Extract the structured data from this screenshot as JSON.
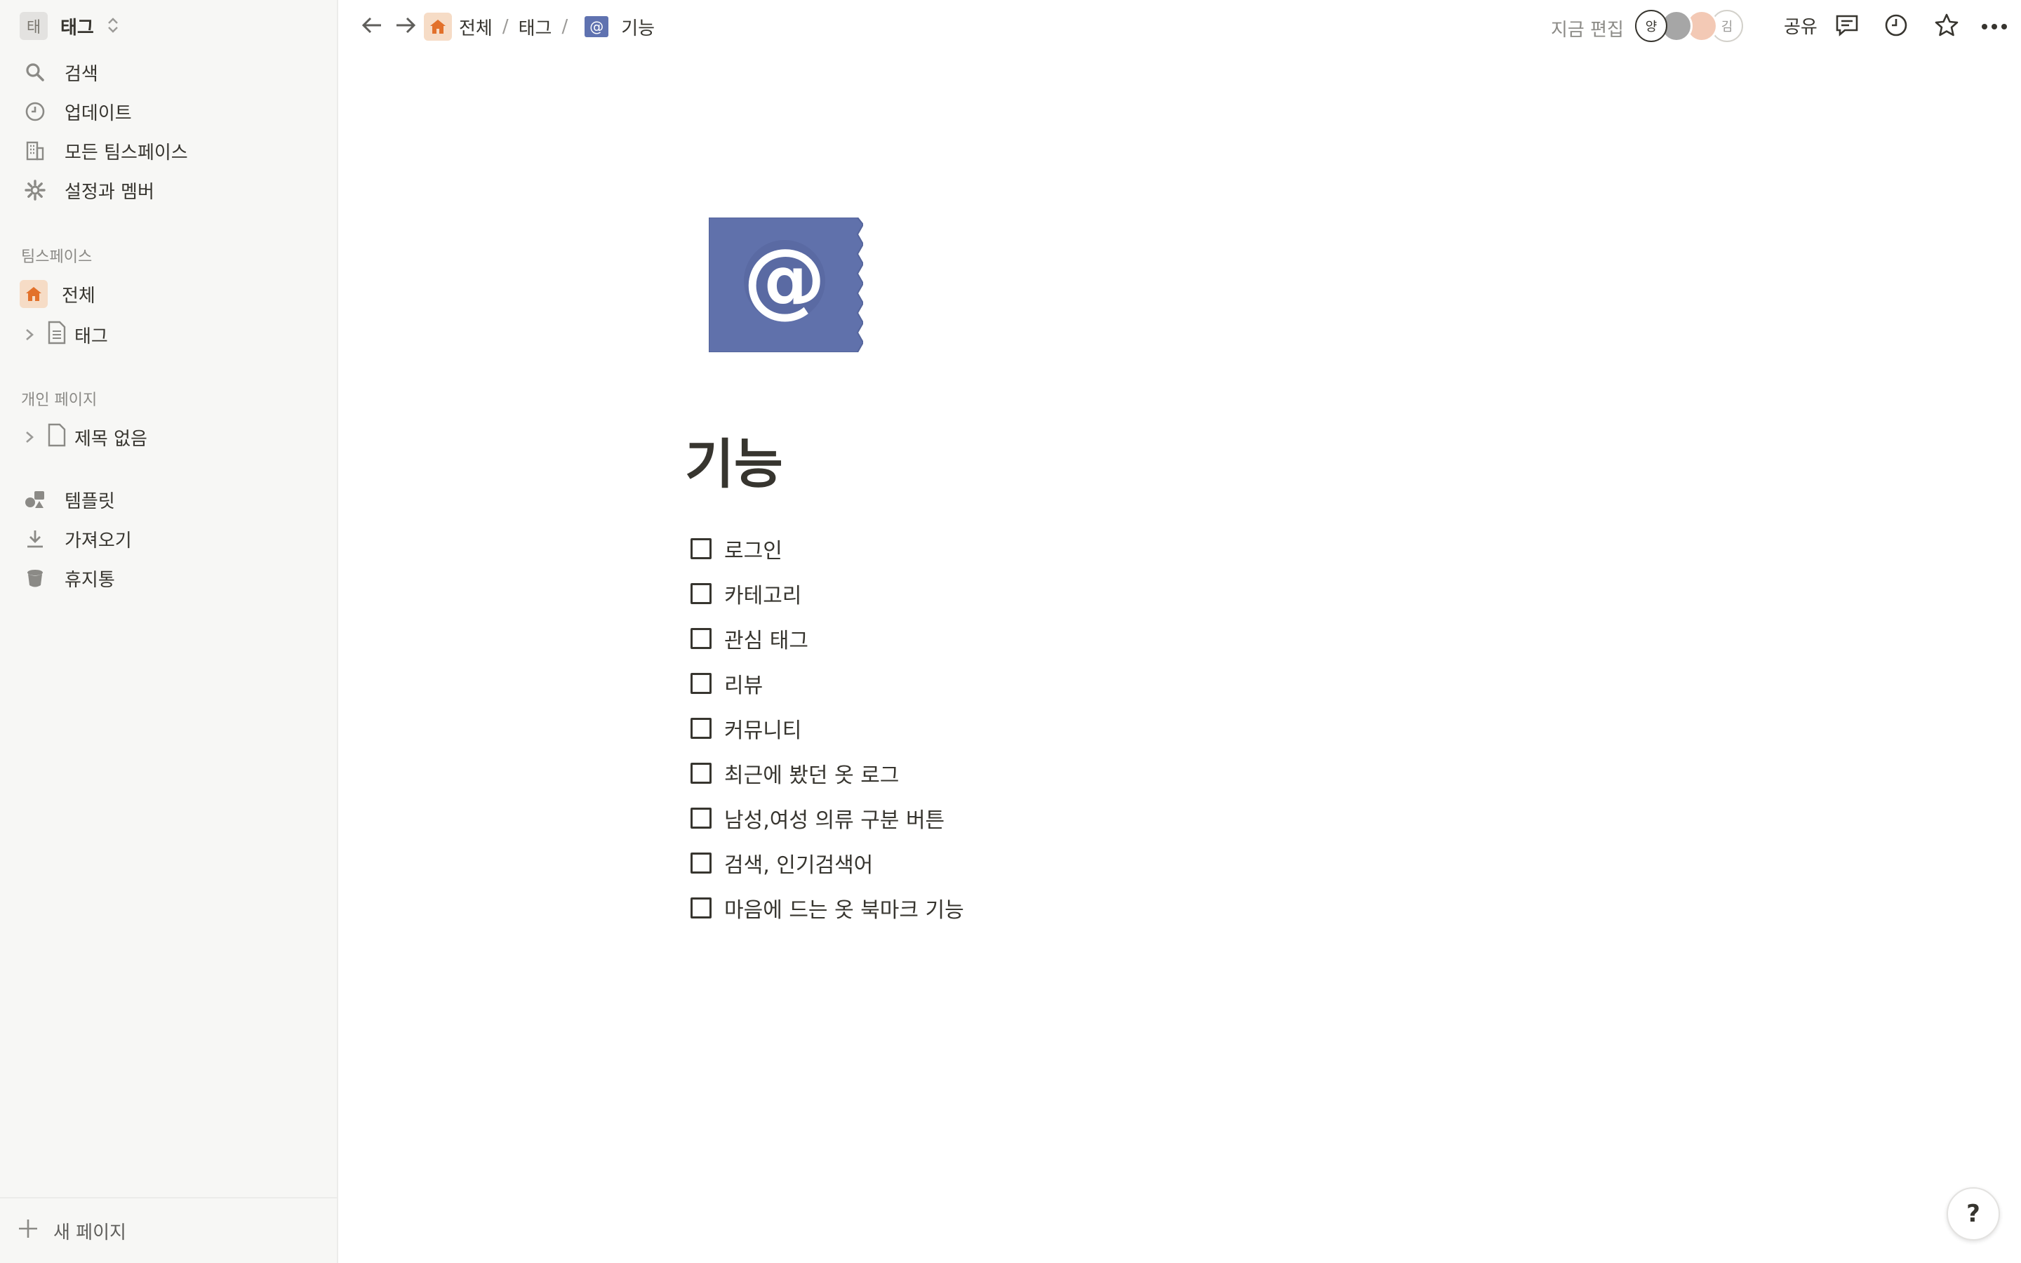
{
  "workspace": {
    "badge": "태",
    "name": "태그"
  },
  "sidebar": {
    "nav": [
      {
        "label": "검색",
        "icon": "search-icon"
      },
      {
        "label": "업데이트",
        "icon": "clock-icon"
      },
      {
        "label": "모든 팀스페이스",
        "icon": "building-icon"
      },
      {
        "label": "설정과 멤버",
        "icon": "gear-icon"
      }
    ],
    "teamspace_header": "팀스페이스",
    "teamspace_items": [
      {
        "label": "전체",
        "icon": "home-icon"
      },
      {
        "label": "태그",
        "icon": "page-icon"
      }
    ],
    "private_header": "개인 페이지",
    "private_items": [
      {
        "label": "제목 없음",
        "icon": "page-icon"
      }
    ],
    "bottom_nav": [
      {
        "label": "템플릿",
        "icon": "shapes-icon"
      },
      {
        "label": "가져오기",
        "icon": "download-icon"
      },
      {
        "label": "휴지통",
        "icon": "trash-icon"
      }
    ],
    "new_page": "새 페이지"
  },
  "topbar": {
    "breadcrumbs": [
      "전체",
      "태그",
      "기능"
    ],
    "separator": "/",
    "crumb_at": "@",
    "editing_label": "지금 편집",
    "avatars": [
      "양",
      "",
      "김"
    ],
    "share": "공유"
  },
  "page": {
    "title": "기능",
    "todos": [
      "로그인",
      "카테고리",
      "관심 태그",
      "리뷰",
      "커뮤니티",
      "최근에 봤던 옷 로그",
      "남성,여성 의류 구분 버튼",
      "검색, 인기검색어",
      "마음에 드는 옷 북마크 기능"
    ]
  },
  "help": "?",
  "colors": {
    "sidebar_bg": "#f7f7f5",
    "text": "#37352f",
    "muted": "#8b8a86",
    "home_accent": "#e2712b",
    "icon_blue": "#5f72b0"
  }
}
